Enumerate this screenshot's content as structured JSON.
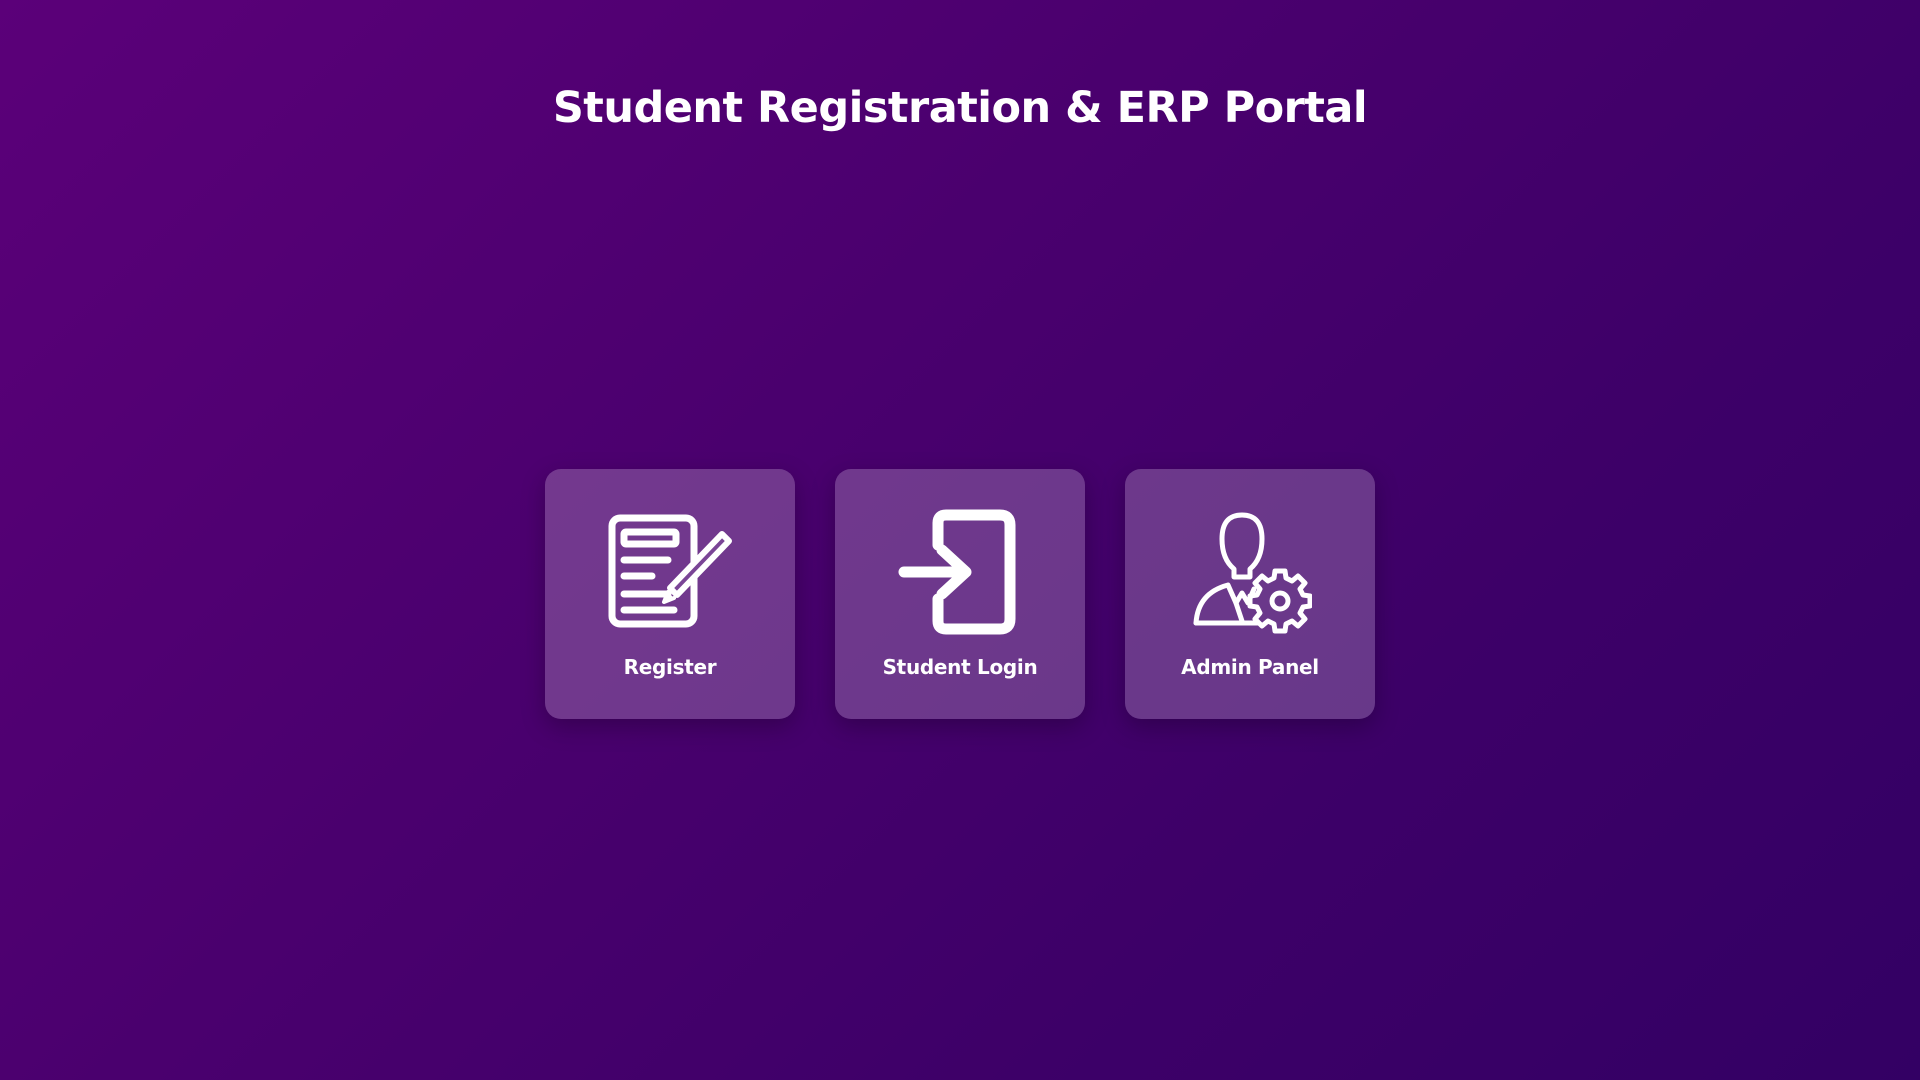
{
  "page": {
    "title": "Student Registration & ERP Portal"
  },
  "cards": [
    {
      "label": "Register",
      "icon": "register-form-icon"
    },
    {
      "label": "Student Login",
      "icon": "login-icon"
    },
    {
      "label": "Admin Panel",
      "icon": "admin-gear-icon"
    }
  ],
  "colors": {
    "background_start": "#5b0079",
    "background_end": "#330064",
    "text": "#ffffff"
  }
}
